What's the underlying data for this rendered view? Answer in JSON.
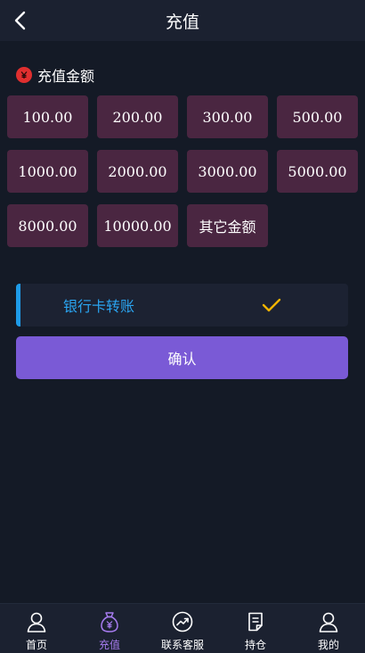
{
  "header": {
    "title": "充值",
    "back_icon": "chevron-left-icon"
  },
  "amount_section": {
    "label": "充值金额",
    "icon": "coin-icon",
    "icon_color": "#e02f2f"
  },
  "amounts": [
    "100.00",
    "200.00",
    "300.00",
    "500.00",
    "1000.00",
    "2000.00",
    "3000.00",
    "5000.00",
    "8000.00",
    "10000.00",
    "其它金额"
  ],
  "payment_method": {
    "label": "银行卡转账",
    "selected": true,
    "check_icon": "checkmark-icon",
    "accent": "#1e9be8",
    "check_color": "#f0b400"
  },
  "confirm_button": {
    "label": "确认",
    "color": "#7a5ad6"
  },
  "tabbar": {
    "items": [
      {
        "label": "首页",
        "icon": "user-icon",
        "active": false
      },
      {
        "label": "充值",
        "icon": "money-bag-icon",
        "active": true
      },
      {
        "label": "联系客服",
        "icon": "chart-icon",
        "active": false
      },
      {
        "label": "持仓",
        "icon": "document-icon",
        "active": false
      },
      {
        "label": "我的",
        "icon": "user-icon",
        "active": false
      }
    ],
    "active_color": "#a77cf0"
  }
}
